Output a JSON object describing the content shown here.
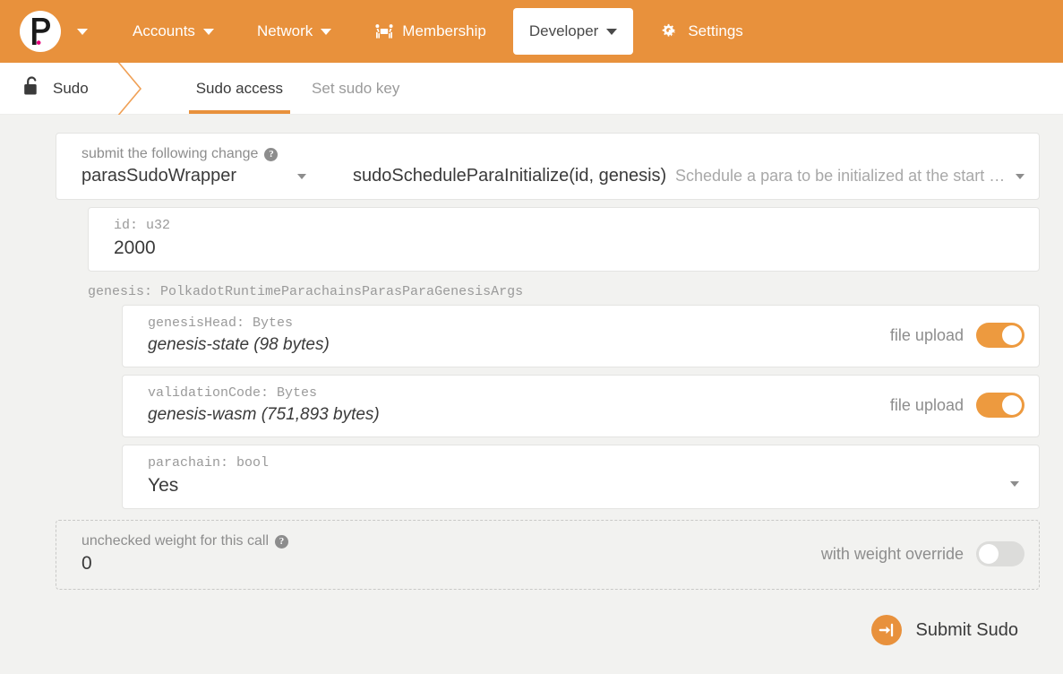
{
  "header": {
    "logo_name": "polkadot-logo",
    "logo_caret_name": "chain-selector-caret",
    "nav": [
      {
        "label": "Accounts",
        "icon": "",
        "has_caret": true,
        "active": false
      },
      {
        "label": "Network",
        "icon": "",
        "has_caret": true,
        "active": false
      },
      {
        "label": "Membership",
        "icon": "people-carry-icon",
        "has_caret": false,
        "active": false
      },
      {
        "label": "Developer",
        "icon": "",
        "has_caret": true,
        "active": true
      },
      {
        "label": "Settings",
        "icon": "cogs-icon",
        "has_caret": false,
        "active": false
      }
    ],
    "bar_color": "#e8913c"
  },
  "tabbar": {
    "section_icon": "unlock-icon",
    "section_title": "Sudo",
    "tabs": [
      {
        "label": "Sudo access",
        "active": true
      },
      {
        "label": "Set sudo key",
        "active": false
      }
    ],
    "accent_color": "#e8913c"
  },
  "call": {
    "label": "submit the following change",
    "help_icon": "help-circle-icon",
    "help_glyph": "?",
    "module": "parasSudoWrapper",
    "method": "sudoScheduleParaInitialize(id, genesis)",
    "description": "Schedule a para to be initialized at the start of…"
  },
  "params": {
    "id": {
      "label": "id: u32",
      "value": "2000"
    },
    "genesis_label": "genesis: PolkadotRuntimeParachainsParasParaGenesisArgs",
    "genesis_head": {
      "label": "genesisHead: Bytes",
      "value": "genesis-state (98 bytes)",
      "toggle_label": "file upload",
      "toggle_on": true
    },
    "validation_code": {
      "label": "validationCode: Bytes",
      "value": "genesis-wasm (751,893 bytes)",
      "toggle_label": "file upload",
      "toggle_on": true
    },
    "parachain": {
      "label": "parachain: bool",
      "value": "Yes"
    }
  },
  "weight": {
    "label": "unchecked weight for this call",
    "help_glyph": "?",
    "value": "0",
    "override_label": "with weight override",
    "override_on": false
  },
  "submit": {
    "label": "Submit Sudo",
    "icon": "sign-in-arrow-icon",
    "icon_color": "#e8913c"
  }
}
